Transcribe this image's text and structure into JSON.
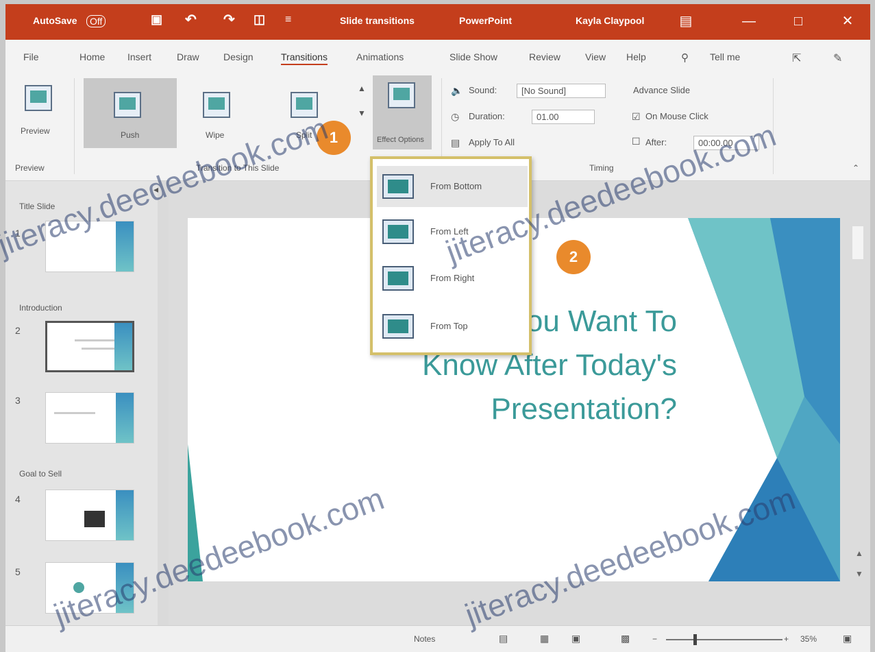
{
  "titlebar": {
    "autosave": "AutoSave",
    "autosave_state": "Off",
    "doc_title": "Slide transitions",
    "app": "PowerPoint",
    "user": "Kayla Claypool"
  },
  "tabs": [
    "File",
    "Home",
    "Insert",
    "Draw",
    "Design",
    "Transitions",
    "Animations",
    "Slide Show",
    "Review",
    "View",
    "Help"
  ],
  "tell_me": "Tell me",
  "ribbon": {
    "preview_label": "Preview",
    "preview_group": "Preview",
    "transitions": [
      "Push",
      "Wipe",
      "Split"
    ],
    "transitions_group": "Transition to This Slide",
    "effect_options": "Effect Options",
    "sound_label": "Sound:",
    "sound_value": "[No Sound]",
    "duration_label": "Duration:",
    "duration_value": "01.00",
    "apply_all": "Apply To All",
    "advance_label": "Advance Slide",
    "on_click": "On Mouse Click",
    "after_label": "After:",
    "after_value": "00:00.00",
    "timing_group": "Timing"
  },
  "dropdown": {
    "options": [
      "From Bottom",
      "From Left",
      "From Right",
      "From Top"
    ]
  },
  "thumbnails": {
    "sections": [
      "Title Slide",
      "Introduction",
      "Goal to Sell"
    ],
    "numbers": [
      "1",
      "2",
      "3",
      "4",
      "5"
    ]
  },
  "slide": {
    "title_lines": [
      "What Do You Want To",
      "Know After Today's",
      "Presentation?"
    ]
  },
  "status": {
    "notes": "Notes",
    "zoom": "35%"
  },
  "callouts": [
    "1",
    "2"
  ],
  "watermark": "jiteracy.deedeebook.com",
  "colors": {
    "accent": "#c43e1c",
    "slide_title": "#3b9a99",
    "callout": "#e98a2c"
  }
}
